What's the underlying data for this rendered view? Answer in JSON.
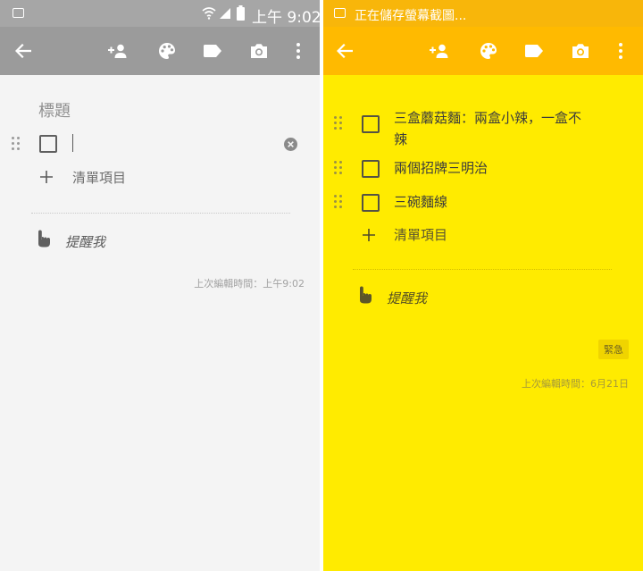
{
  "left": {
    "status": {
      "time": "上午 9:02"
    },
    "editor": {
      "title_placeholder": "標題",
      "add_item_label": "清單項目",
      "reminder_label": "提醒我",
      "edited_label": "上次編輯時間：上午9:02"
    }
  },
  "right": {
    "status": {
      "notification": "正在儲存螢幕截圖..."
    },
    "editor": {
      "items": [
        {
          "line1": "三盒蘑菇麵：兩盒小辣，一盒不",
          "line2": "辣"
        },
        {
          "text": "兩個招牌三明治"
        },
        {
          "text": "三碗麵線"
        }
      ],
      "add_item_label": "清單項目",
      "reminder_label": "提醒我",
      "tag": "緊急",
      "edited_label": "上次編輯時間：6月21日"
    }
  },
  "icons": {
    "back": "arrow-left-icon",
    "collaborator": "person-add-icon",
    "color": "palette-icon",
    "label": "label-tag-icon",
    "camera": "camera-icon",
    "more": "more-vert-icon",
    "reminder": "hand-point-icon",
    "clear": "clear-circle-icon",
    "drag": "drag-handle-icon"
  },
  "colors": {
    "left_background": "#f4f4f4",
    "left_toolbar": "#9b9b9b",
    "right_background": "#ffeb00",
    "right_toolbar": "#ffba00"
  }
}
